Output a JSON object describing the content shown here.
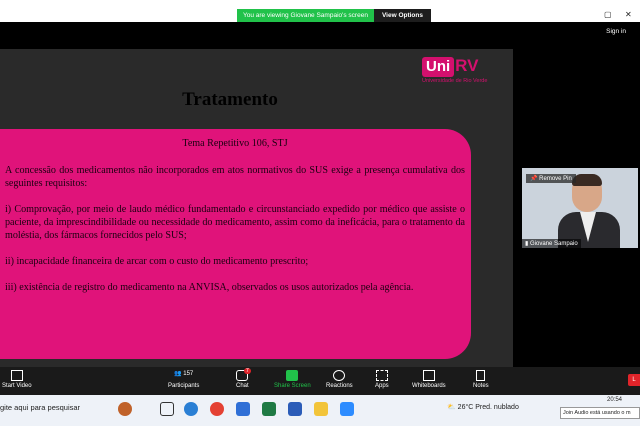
{
  "banner": {
    "viewing_text": "You are viewing Giovane Sampaio's screen",
    "view_options": "View Options"
  },
  "signin": "Sign in",
  "slide": {
    "logo_uni": "Uni",
    "logo_rv": "RV",
    "logo_sub": "Universidade de Rio Verde",
    "title": "Tratamento",
    "box_heading": "Tema Repetitivo 106, STJ",
    "paragraphs": [
      "A concessão dos medicamentos não incorporados em atos normativos do SUS exige a presença cumulativa dos seguintes requisitos:",
      "i) Comprovação, por meio de laudo médico fundamentado e circunstanciado expedido por médico que assiste o paciente, da imprescindibilidade ou necessidade do medicamento, assim como da ineficácia, para o tratamento da moléstia, dos fármacos fornecidos pelo SUS;",
      "ii) incapacidade financeira de arcar com o custo do medicamento prescrito;",
      "iii) existência de registro do medicamento na ANVISA, observados os usos autorizados pela agência."
    ]
  },
  "video_tile": {
    "remove_pin": "Remove Pin",
    "name": "Giovane Sampaio"
  },
  "toolbar": {
    "start_video": "Start Video",
    "participants": "Participants",
    "participants_count": "157",
    "chat": "Chat",
    "chat_badge": "7",
    "share_screen": "Share Screen",
    "reactions": "Reactions",
    "apps": "Apps",
    "whiteboards": "Whiteboards",
    "notes": "Notes",
    "leave": "L"
  },
  "taskbar": {
    "search": "gite aqui para pesquisar",
    "weather": "26°C  Pred. nublado",
    "clock": "20:54",
    "toast": "Join Audio está usando o m"
  },
  "colors": {
    "accent_pink": "#e0137a",
    "zoom_green": "#21c24a"
  }
}
